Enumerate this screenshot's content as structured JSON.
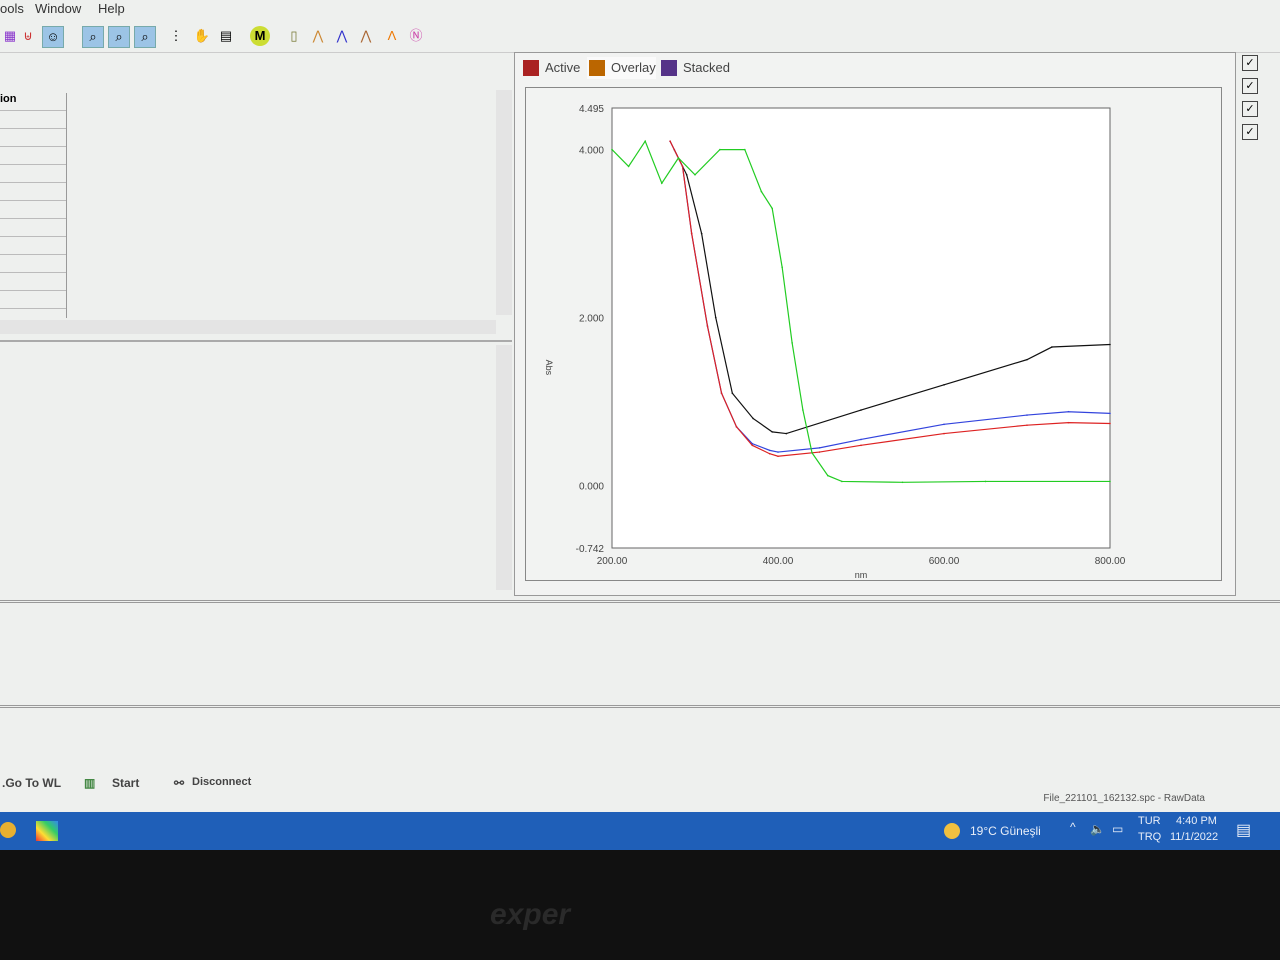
{
  "menu": [
    "ools",
    "Window",
    "Help"
  ],
  "tabs": [
    {
      "label": "Active"
    },
    {
      "label": "Overlay"
    },
    {
      "label": "Stacked"
    }
  ],
  "left_table": {
    "header": "ion"
  },
  "buttons": {
    "goto": ".Go To WL",
    "start": "Start",
    "disconnect": "Disconnect"
  },
  "status": {
    "file": "File_221101_162132.spc - RawData"
  },
  "taskbar": {
    "weather": "19°C  Güneşli",
    "lang1": "TUR",
    "lang2": "TRQ",
    "time": "4:40 PM",
    "date": "11/1/2022"
  },
  "bezel": {
    "brand": "exper"
  },
  "chart_data": {
    "type": "line",
    "title": "",
    "xlabel": "nm",
    "ylabel": "Abs",
    "xlim": [
      200,
      800
    ],
    "ylim": [
      -0.742,
      4.495
    ],
    "xticks": [
      "200.00",
      "400.00",
      "600.00",
      "800.00"
    ],
    "yticks": [
      "4.495",
      "4.000",
      "2.000",
      "0.000",
      "-0.742"
    ],
    "series": [
      {
        "name": "black",
        "color": "#111111",
        "x": [
          275,
          290,
          308,
          325,
          345,
          370,
          393,
          410,
          500,
          600,
          700,
          730,
          800
        ],
        "y": [
          4.0,
          3.7,
          3.0,
          2.0,
          1.1,
          0.8,
          0.64,
          0.62,
          0.9,
          1.2,
          1.5,
          1.65,
          1.68
        ]
      },
      {
        "name": "blue",
        "color": "#3344dd",
        "x": [
          270,
          285,
          296,
          315,
          332,
          350,
          369,
          390,
          400,
          450,
          500,
          600,
          700,
          750,
          800
        ],
        "y": [
          4.1,
          3.8,
          3.0,
          1.9,
          1.1,
          0.7,
          0.5,
          0.42,
          0.4,
          0.45,
          0.55,
          0.73,
          0.84,
          0.88,
          0.86
        ]
      },
      {
        "name": "red",
        "color": "#dd2222",
        "x": [
          270,
          285,
          296,
          315,
          332,
          350,
          369,
          390,
          400,
          450,
          500,
          600,
          700,
          750,
          800
        ],
        "y": [
          4.1,
          3.8,
          3.0,
          1.9,
          1.1,
          0.7,
          0.48,
          0.38,
          0.35,
          0.4,
          0.48,
          0.62,
          0.72,
          0.75,
          0.74
        ]
      },
      {
        "name": "green",
        "color": "#22cc22",
        "x": [
          200,
          220,
          240,
          260,
          280,
          300,
          330,
          360,
          380,
          393,
          405,
          417,
          430,
          441,
          460,
          477,
          550,
          650,
          800
        ],
        "y": [
          4.0,
          3.8,
          4.1,
          3.6,
          3.9,
          3.7,
          4.0,
          4.0,
          3.5,
          3.3,
          2.6,
          1.7,
          0.9,
          0.39,
          0.12,
          0.05,
          0.04,
          0.05,
          0.05
        ]
      }
    ]
  }
}
